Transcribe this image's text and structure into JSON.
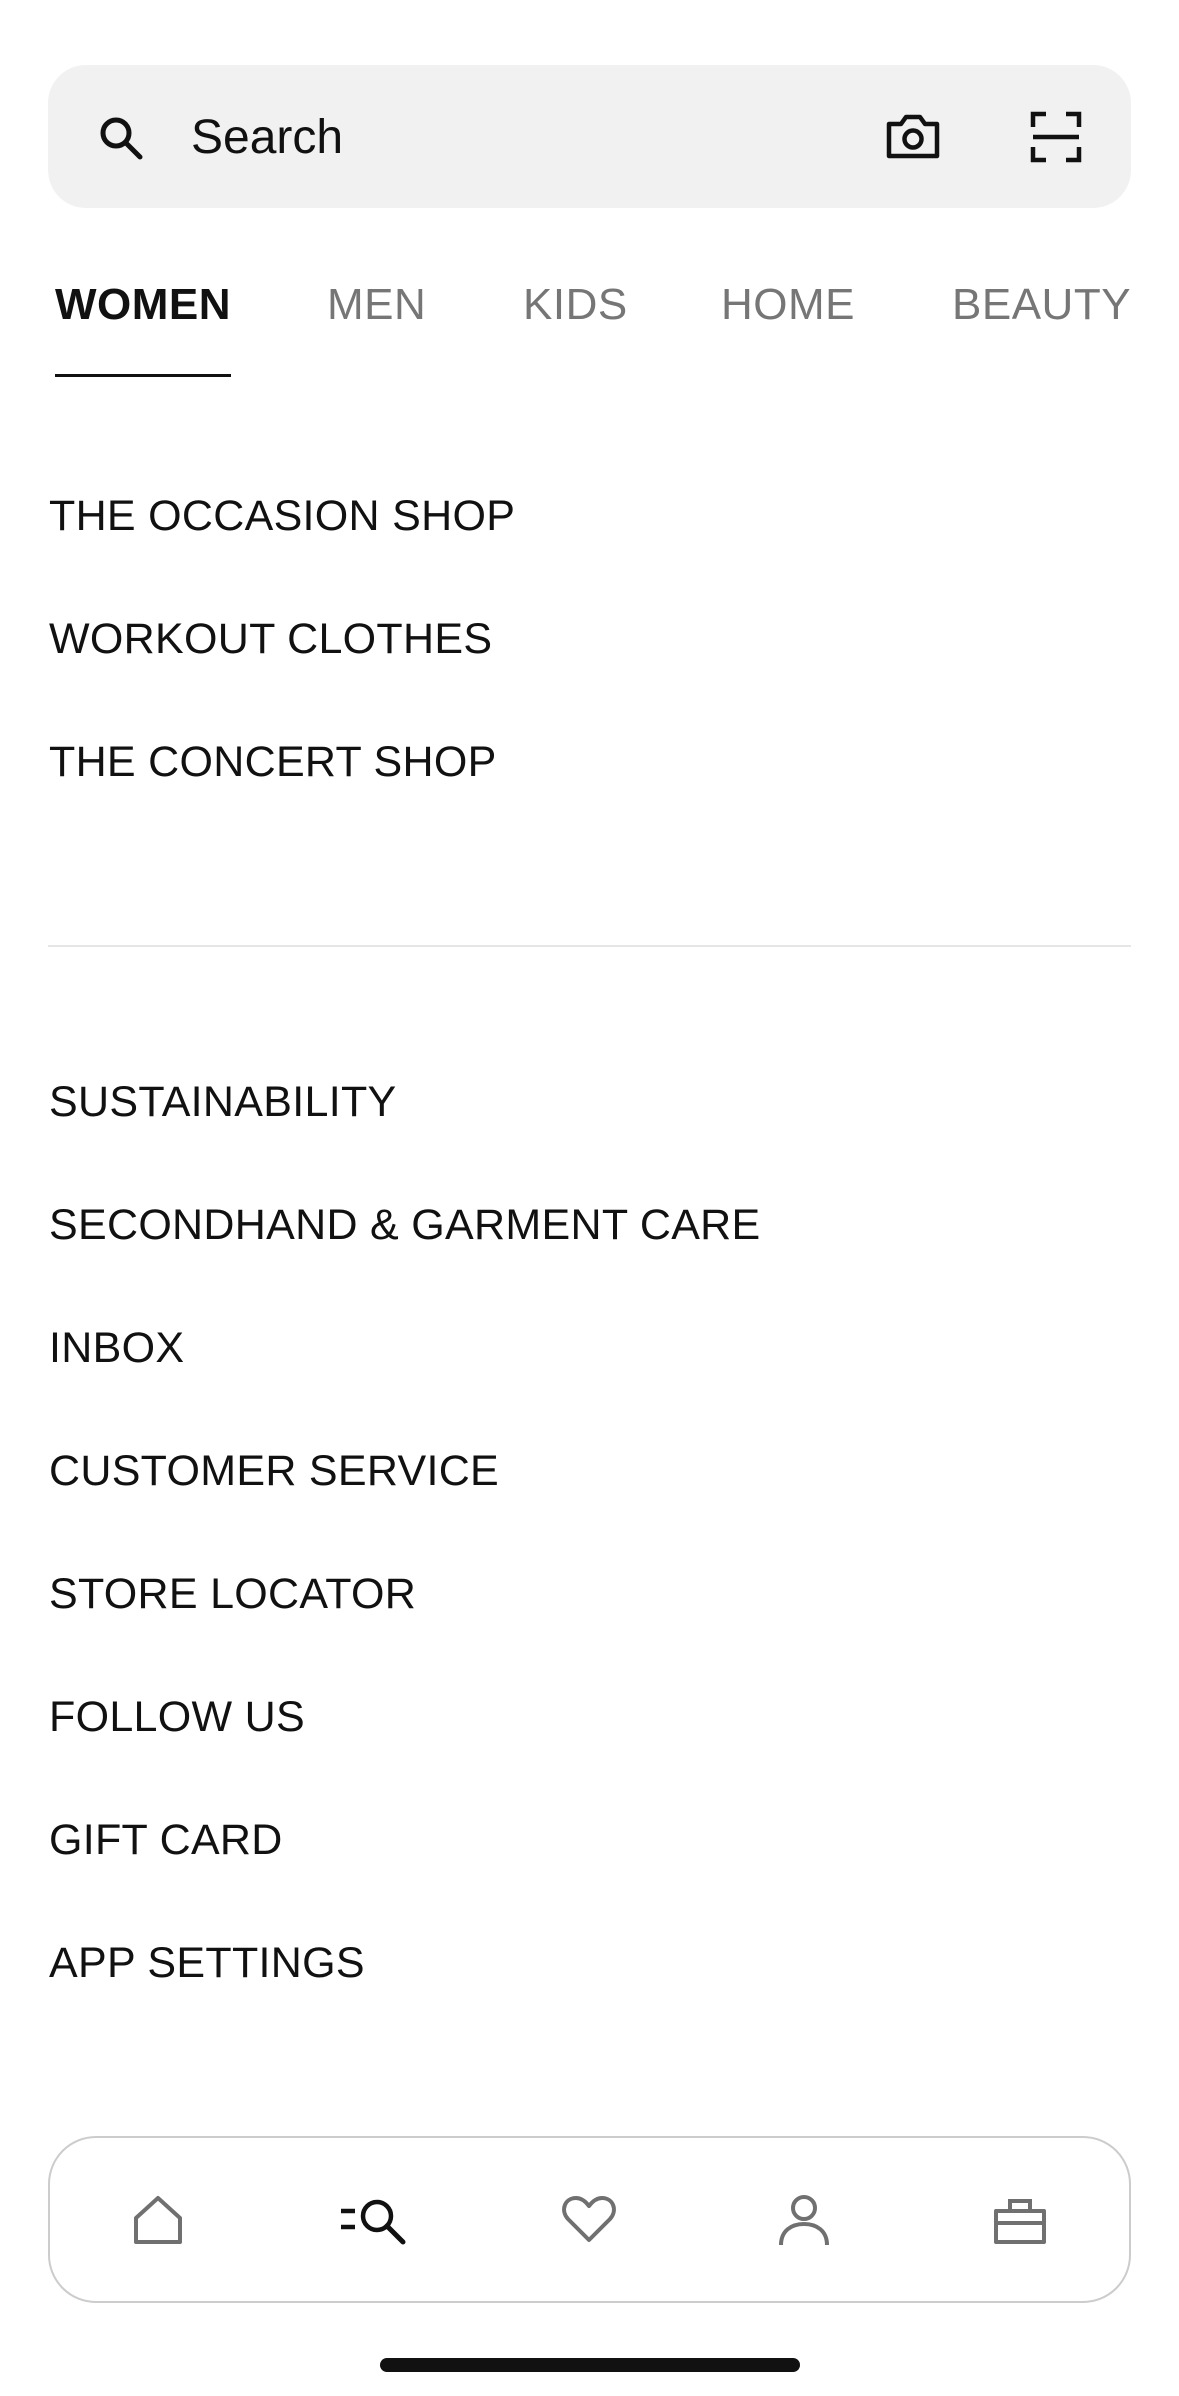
{
  "search": {
    "placeholder": "Search",
    "icon": "search-icon",
    "camera_icon": "camera-icon",
    "scan_icon": "scan-icon"
  },
  "tabs": [
    {
      "label": "WOMEN",
      "active": true
    },
    {
      "label": "MEN",
      "active": false
    },
    {
      "label": "KIDS",
      "active": false
    },
    {
      "label": "HOME",
      "active": false
    },
    {
      "label": "BEAUTY",
      "active": false
    }
  ],
  "featured": [
    {
      "label": "THE OCCASION SHOP"
    },
    {
      "label": "WORKOUT CLOTHES"
    },
    {
      "label": "THE CONCERT SHOP"
    }
  ],
  "links": [
    {
      "label": "SUSTAINABILITY"
    },
    {
      "label": "SECONDHAND & GARMENT CARE"
    },
    {
      "label": "INBOX"
    },
    {
      "label": "CUSTOMER SERVICE"
    },
    {
      "label": "STORE LOCATOR"
    },
    {
      "label": "FOLLOW US"
    },
    {
      "label": "GIFT CARD"
    },
    {
      "label": "APP SETTINGS"
    }
  ],
  "bottom_nav": [
    {
      "icon": "home-icon",
      "active": false
    },
    {
      "icon": "menu-search-icon",
      "active": true
    },
    {
      "icon": "heart-icon",
      "active": false
    },
    {
      "icon": "person-icon",
      "active": false
    },
    {
      "icon": "shopping-bag-icon",
      "active": false
    }
  ],
  "colors": {
    "text": "#111111",
    "inactive_tab": "#767676",
    "search_bg": "#f1f1f1",
    "icon_inactive": "#707070"
  }
}
